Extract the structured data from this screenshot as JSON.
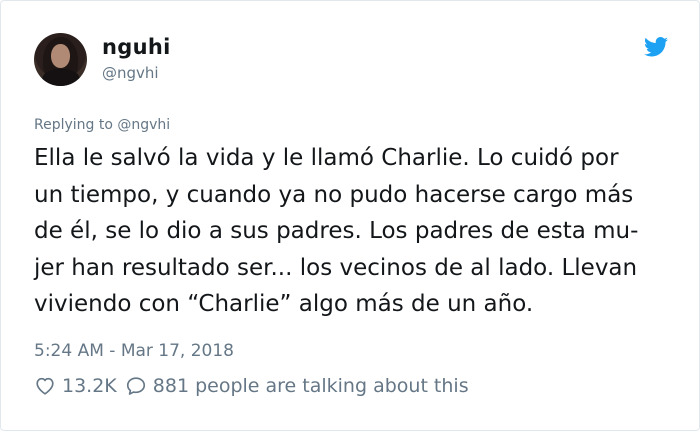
{
  "user": {
    "name": "nguhi",
    "handle": "@ngvhi"
  },
  "replying": {
    "prefix": "Replying to",
    "mention": "@ngvhi"
  },
  "tweet": {
    "lines": [
      "Ella le salvó la vida y le llamó Charlie. Lo cuidó por",
      "un tiempo, y cuando ya no pudo hacerse cargo más",
      "de él, se lo dio a sus padres. Los padres de esta mu-",
      "jer han resultado ser... los vecinos de al lado. Llevan",
      "viviendo con “Charlie” algo más de un año."
    ],
    "timestamp": "5:24 AM - Mar 17, 2018"
  },
  "stats": {
    "likes": "13.2K",
    "replies_text": "881 people are talking about this"
  },
  "icons": {
    "brand": "twitter-bird-icon",
    "like": "heart-icon",
    "reply": "speech-bubble-icon"
  },
  "colors": {
    "twitter_blue": "#1da1f2",
    "text": "#14171a",
    "secondary": "#657786"
  }
}
